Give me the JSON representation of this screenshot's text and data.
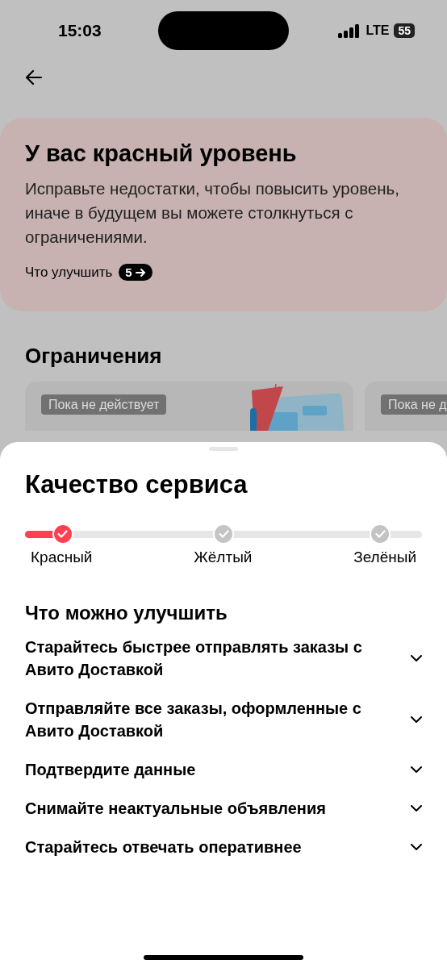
{
  "status_bar": {
    "time": "15:03",
    "network": "LTE",
    "battery": "55"
  },
  "level_card": {
    "title": "У вас красный уровень",
    "text": "Исправьте недостатки, чтобы повысить уровень, иначе в будущем вы можете столкнуться с ограничениями.",
    "link": "Что улучшить",
    "count": "5"
  },
  "restrictions": {
    "title": "Ограничения",
    "cards": [
      {
        "badge": "Пока не действует"
      },
      {
        "badge": "Пока не д"
      }
    ]
  },
  "sheet": {
    "title": "Качество сервиса",
    "levels": [
      {
        "label": "Красный",
        "selected": true
      },
      {
        "label": "Жёлтый",
        "selected": false
      },
      {
        "label": "Зелёный",
        "selected": false
      }
    ],
    "improve_title": "Что можно улучшить",
    "items": [
      {
        "title": "Старайтесь быстрее отправлять заказы с Авито Доставкой",
        "expanded": false
      },
      {
        "title": "Отправляйте все заказы, оформленные с Авито Доставкой",
        "expanded": false
      },
      {
        "title": "Подтвердите данные",
        "expanded": false
      },
      {
        "title": "Снимайте неактуальные объявления",
        "expanded": false
      },
      {
        "title": "Старайтесь отвечать оперативнее",
        "expanded": false
      }
    ]
  }
}
